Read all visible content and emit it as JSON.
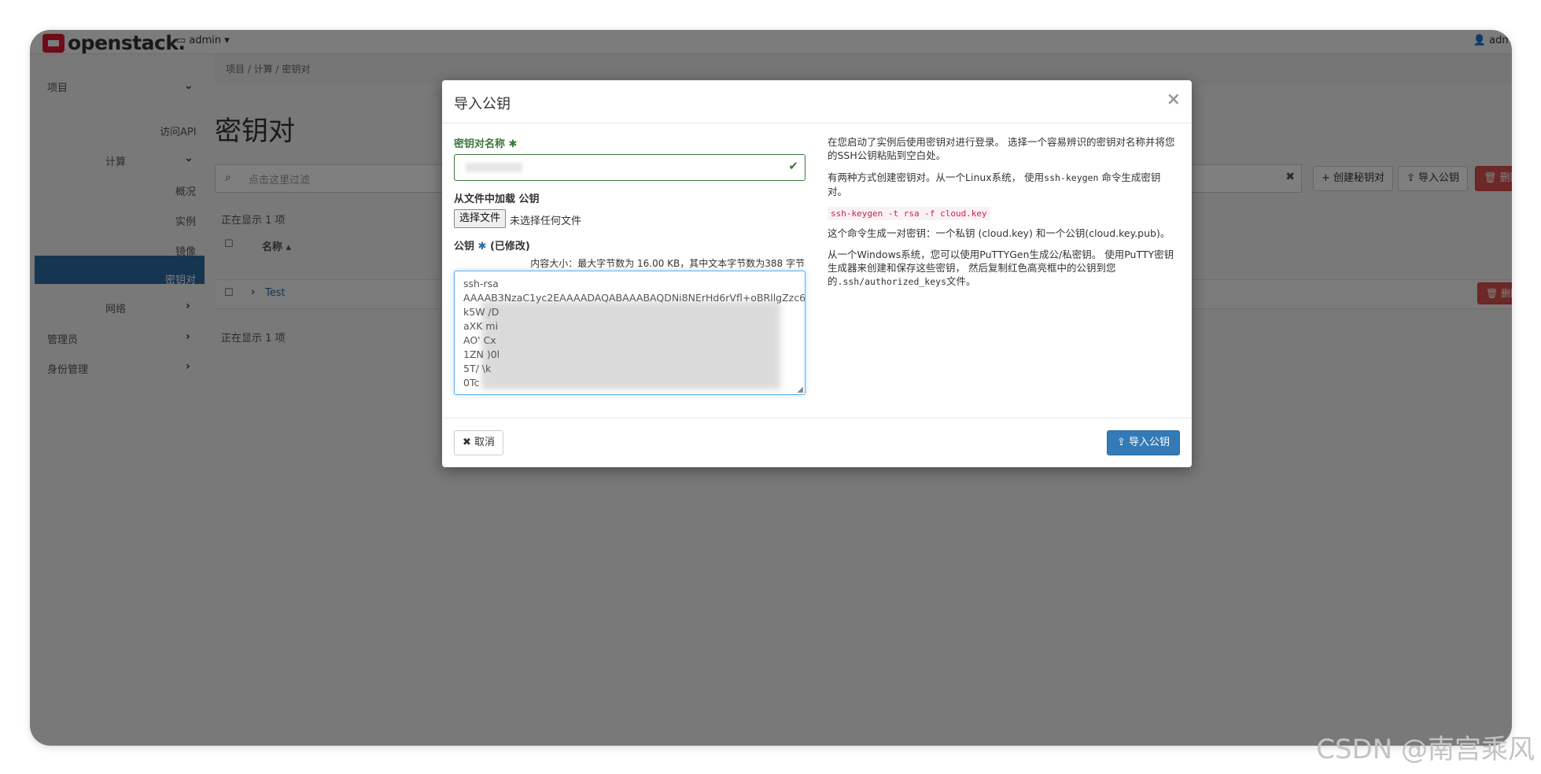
{
  "topbar": {
    "logo_text": "openstack.",
    "project": "admin ▾",
    "user": "adm"
  },
  "sidebar": {
    "items": [
      {
        "label": "项目"
      },
      {
        "label": "访问API"
      },
      {
        "label": "计算"
      },
      {
        "label": "概况"
      },
      {
        "label": "实例"
      },
      {
        "label": "镜像"
      },
      {
        "label": "密钥对"
      },
      {
        "label": "网络"
      },
      {
        "label": "管理员"
      },
      {
        "label": "身份管理"
      }
    ]
  },
  "main": {
    "breadcrumb": "项目 /  计算 /  密钥对",
    "title": "密钥对",
    "filter_placeholder": "点击这里过滤",
    "buttons": {
      "create": "创建秘钥对",
      "import": "导入公钥",
      "delete": "删除密钥对"
    },
    "showing_top": "正在显示 1 项",
    "column_name": "名称 ▴",
    "row_name": "Test",
    "row_delete": "删除密钥对",
    "showing_bottom": "正在显示 1 项"
  },
  "modal": {
    "title": "导入公钥",
    "name_label": "密钥对名称",
    "file_label": "从文件中加载 公钥",
    "file_button": "选择文件",
    "file_none": "未选择任何文件",
    "key_label": "公钥",
    "key_modified": "(已修改)",
    "size_hint": "内容大小：最大字节数为 16.00 KB，其中文本字节数为388 字节",
    "key_lines": [
      "ssh-rsa",
      "AAAAB3NzaC1yc2EAAAADAQABAAABAQDNi8NErHd6rVfl+oBRllgZzc6",
      "k5W                                                   /D",
      "aXK                                                   mi",
      "AO'                                                   Cx",
      "1ZN                                                   )0l",
      "5T/                                                   \\k",
      "0Tc"
    ],
    "help": {
      "p1": "在您启动了实例后使用密钥对进行登录。 选择一个容易辨识的密钥对名称并将您的SSH公钥粘贴到空白处。",
      "p2_a": "有两种方式创建密钥对。从一个Linux系统， 使用",
      "p2_code": "ssh-keygen",
      "p2_b": " 命令生成密钥对。",
      "cmd": "ssh-keygen -t rsa -f cloud.key",
      "p3": "这个命令生成一对密钥：一个私钥 (cloud.key) 和一个公钥(cloud.key.pub)。",
      "p4_a": "从一个Windows系统，您可以使用PuTTYGen生成公/私密钥。 使用PuTTY密钥生成器来创建和保存这些密钥， 然后复制红色高亮框中的公钥到您的",
      "p4_code": ".ssh/authorized_keys",
      "p4_b": "文件。"
    },
    "cancel": "取消",
    "submit": "导入公钥"
  },
  "watermark": "CSDN @南宫乘风"
}
